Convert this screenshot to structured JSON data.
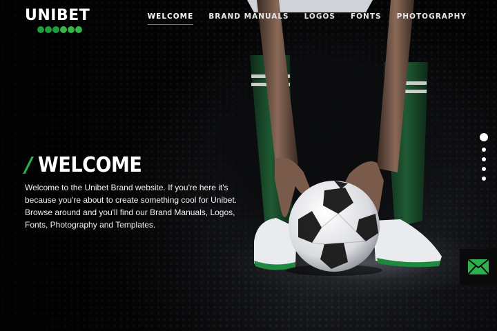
{
  "brand": {
    "name": "UNIBET",
    "accent": "#2bb24c",
    "dot_colors": [
      "#1f9d3c",
      "#35b44a"
    ]
  },
  "nav": {
    "items": [
      {
        "label": "WELCOME",
        "active": true
      },
      {
        "label": "BRAND MANUALS",
        "active": false
      },
      {
        "label": "LOGOS",
        "active": false
      },
      {
        "label": "FONTS",
        "active": false
      },
      {
        "label": "PHOTOGRAPHY",
        "active": false
      }
    ]
  },
  "hero": {
    "slash": "/",
    "title": "WELCOME",
    "body": "Welcome to the Unibet Brand website. If you're here it's because you're about to create something cool for Unibet. Browse around and you'll find our Brand Manuals, Logos, Fonts, Photography and Templates."
  },
  "pager": {
    "count": 5,
    "active_index": 0
  },
  "icons": {
    "mail": "mail-icon"
  }
}
